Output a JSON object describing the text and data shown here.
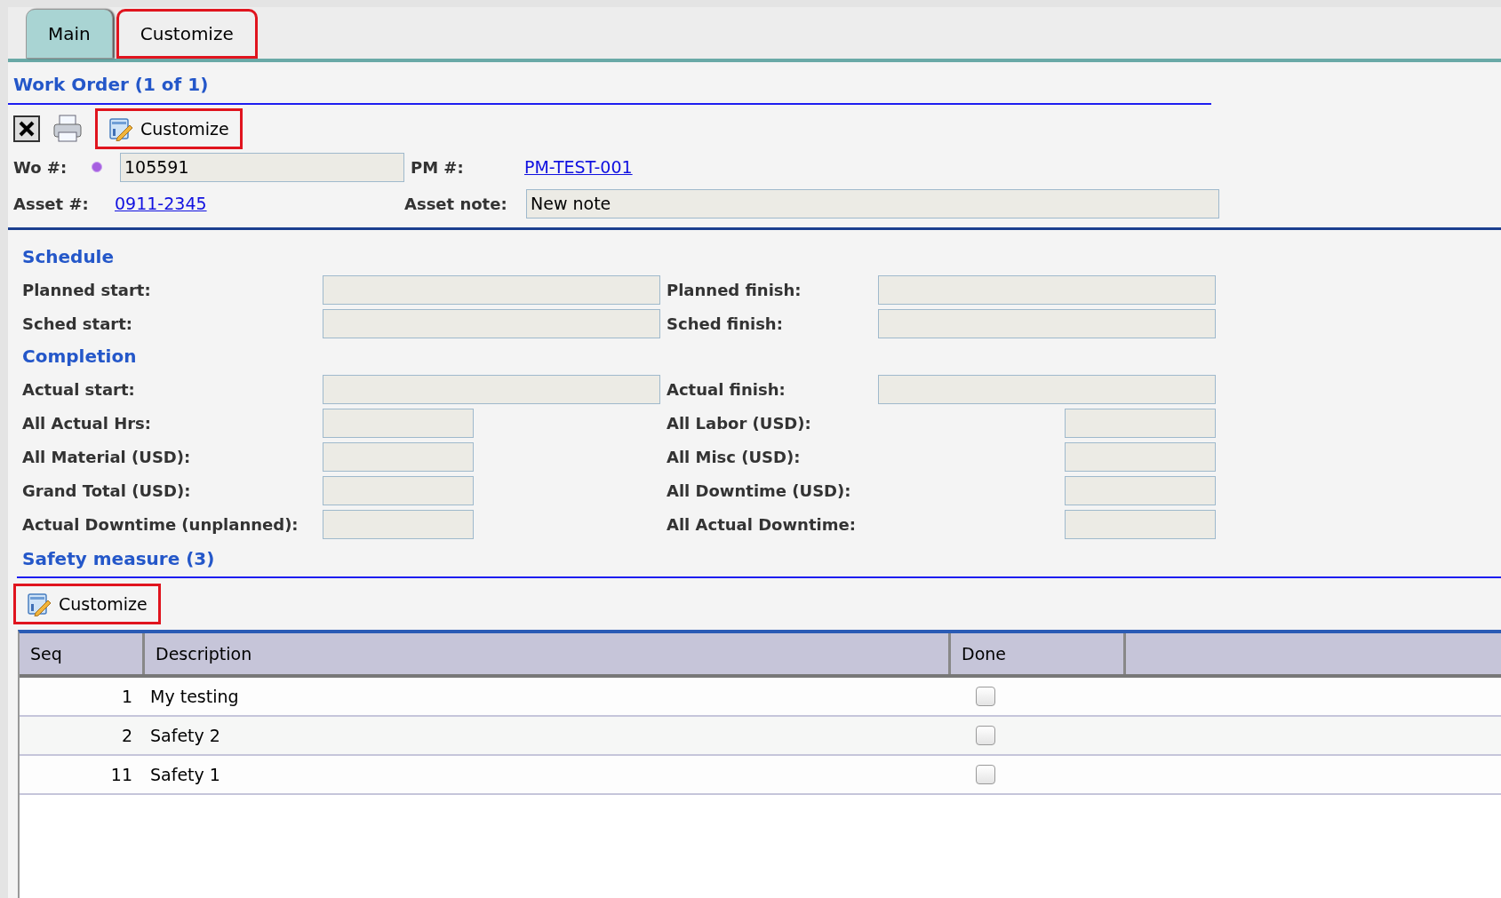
{
  "tabs": [
    {
      "label": "Main",
      "selected": true,
      "highlighted": false
    },
    {
      "label": "Customize",
      "selected": false,
      "highlighted": true
    }
  ],
  "header": {
    "title": "Work Order (1 of 1)"
  },
  "toolbar": {
    "customize": {
      "label": "Customize",
      "highlighted": true
    }
  },
  "summary": {
    "wo_label": "Wo #:",
    "wo_value": "105591",
    "pm_label": "PM #:",
    "pm_link": "PM-TEST-001",
    "asset_label": "Asset #:",
    "asset_link": "0911-2345",
    "asset_note_label": "Asset note:",
    "asset_note_value": "New note"
  },
  "sections": [
    {
      "title": "Schedule",
      "rows": [
        {
          "kind": "wide",
          "left_label": "Planned start:",
          "right_label": "Planned finish:"
        },
        {
          "kind": "wide",
          "left_label": "Sched start:",
          "right_label": "Sched finish:"
        }
      ]
    },
    {
      "title": "Completion",
      "rows": [
        {
          "kind": "wide",
          "left_label": "Actual start:",
          "right_label": "Actual finish:"
        },
        {
          "kind": "narrow",
          "left_label": "All Actual Hrs:",
          "right_label": "All Labor (USD):"
        },
        {
          "kind": "narrow",
          "left_label": "All Material (USD):",
          "right_label": "All Misc (USD):"
        },
        {
          "kind": "narrow",
          "left_label": "Grand Total (USD):",
          "right_label": "All Downtime (USD):"
        },
        {
          "kind": "narrow",
          "left_label": "Actual Downtime (unplanned):",
          "right_label": "All Actual Downtime:"
        }
      ]
    }
  ],
  "safety": {
    "title": "Safety measure (3)",
    "customize": {
      "label": "Customize",
      "highlighted": true
    },
    "columns": [
      "Seq",
      "Description",
      "Done"
    ],
    "rows": [
      {
        "seq": "1",
        "description": "My testing",
        "done": false
      },
      {
        "seq": "2",
        "description": "Safety 2",
        "done": false
      },
      {
        "seq": "11",
        "description": "Safety 1",
        "done": false
      }
    ]
  }
}
